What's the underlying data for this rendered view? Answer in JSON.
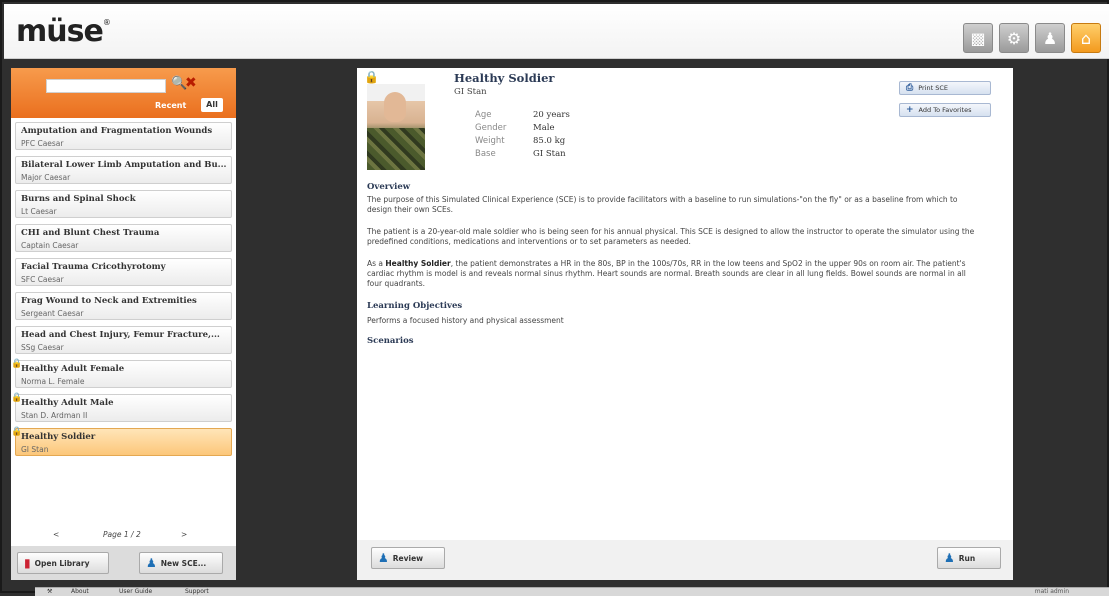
{
  "app": {
    "logo": "müse",
    "logo_mark": "®"
  },
  "header": {
    "icons": [
      "clipboard-icon",
      "gear-icon",
      "user-icon",
      "home-icon"
    ]
  },
  "sidebar": {
    "search": {
      "value": "",
      "placeholder": ""
    },
    "tabs": {
      "recent": "Recent",
      "all": "All"
    },
    "items": [
      {
        "title": "Amputation and Fragmentation Wounds",
        "sub": "PFC Caesar",
        "locked": false,
        "selected": false
      },
      {
        "title": "Bilateral Lower Limb Amputation and Bu...",
        "sub": "Major Caesar",
        "locked": false,
        "selected": false
      },
      {
        "title": "Burns and Spinal Shock",
        "sub": "Lt Caesar",
        "locked": false,
        "selected": false
      },
      {
        "title": "CHI and Blunt Chest Trauma",
        "sub": "Captain Caesar",
        "locked": false,
        "selected": false
      },
      {
        "title": "Facial Trauma Cricothyrotomy",
        "sub": "SFC Caesar",
        "locked": false,
        "selected": false
      },
      {
        "title": "Frag Wound to Neck and Extremities",
        "sub": "Sergeant Caesar",
        "locked": false,
        "selected": false
      },
      {
        "title": "Head and Chest Injury, Femur Fracture,...",
        "sub": "SSg Caesar",
        "locked": false,
        "selected": false
      },
      {
        "title": "Healthy Adult Female",
        "sub": "Norma L. Female",
        "locked": true,
        "selected": false
      },
      {
        "title": "Healthy Adult Male",
        "sub": "Stan D. Ardman II",
        "locked": true,
        "selected": false
      },
      {
        "title": "Healthy Soldier",
        "sub": "GI Stan",
        "locked": true,
        "selected": true
      }
    ],
    "pager": {
      "prev": "<",
      "text": "Page 1 / 2",
      "next": ">"
    },
    "buttons": {
      "open_library": "Open Library",
      "new_sce": "New SCE..."
    }
  },
  "patient": {
    "name": "Healthy Soldier",
    "subtitle": "GI Stan",
    "attributes": [
      {
        "label": "Age",
        "value": "20 years"
      },
      {
        "label": "Gender",
        "value": "Male"
      },
      {
        "label": "Weight",
        "value": "85.0 kg"
      },
      {
        "label": "Base",
        "value": "GI Stan"
      }
    ],
    "actions": {
      "print": "Print SCE",
      "favorite": "Add To Favorites"
    }
  },
  "overview": {
    "heading": "Overview",
    "p1": "The purpose of this Simulated Clinical Experience (SCE) is to provide facilitators with a baseline to run simulations-\"on the fly\" or as a baseline from which to design their own SCEs.",
    "p2": "The patient is a 20-year-old male soldier who is being seen for his annual physical. This SCE is designed to allow the instructor to operate the simulator using the predefined conditions, medications and interventions or to set parameters as needed.",
    "p3_prefix": "As a ",
    "p3_bold": "Healthy Soldier",
    "p3_rest": ", the patient demonstrates a HR in the 80s, BP in the 100s/70s, RR in the low teens and SpO2 in the upper 90s on room air. The patient's cardiac rhythm is model is and reveals normal sinus rhythm. Heart sounds are normal. Breath sounds are clear in all lung fields. Bowel sounds are normal in all four quadrants."
  },
  "learning": {
    "heading": "Learning Objectives",
    "text": "Performs a focused history and physical assessment"
  },
  "scenarios": {
    "heading": "Scenarios"
  },
  "content_buttons": {
    "review": "Review",
    "run": "Run"
  },
  "taskbar": {
    "about": "About",
    "user_guide": "User Guide",
    "support": "Support",
    "user": "mati admin"
  }
}
